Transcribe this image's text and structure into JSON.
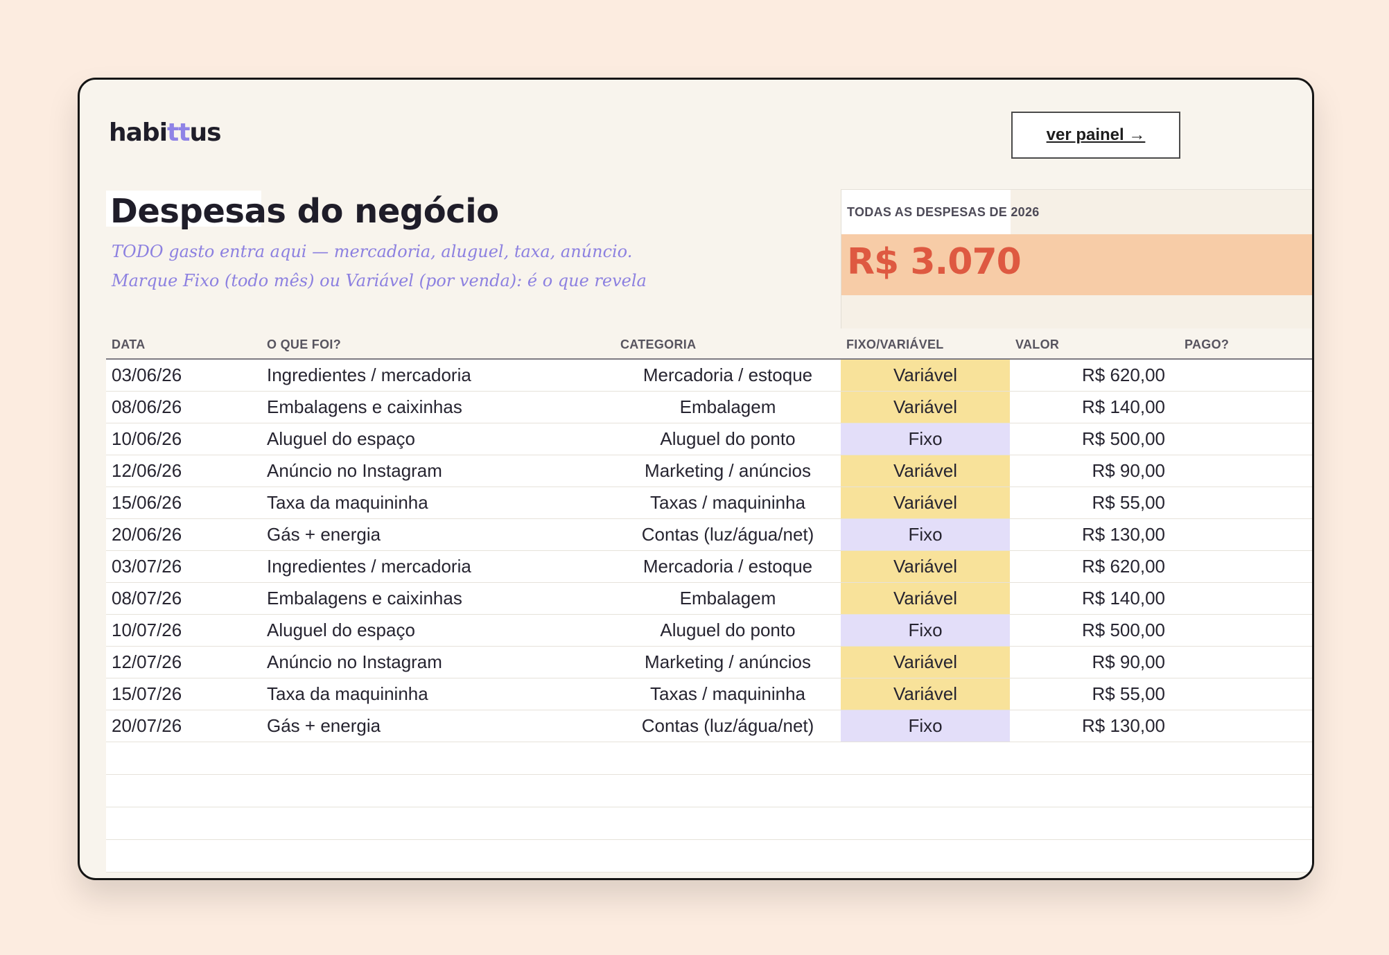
{
  "app": {
    "logo_prefix": "habi",
    "logo_highlight": "tt",
    "logo_suffix": "us"
  },
  "header": {
    "panel_button": "ver painel →"
  },
  "page": {
    "title": "Despesas do negócio",
    "subtitle_line1": "TODO gasto entra aqui — mercadoria, aluguel, taxa, anúncio.",
    "subtitle_line2": "Marque Fixo (todo mês) ou Variável (por venda): é o que revela"
  },
  "summary": {
    "label": "TODAS AS DESPESAS DE 2026",
    "value": "R$ 3.070"
  },
  "table": {
    "columns": [
      "DATA",
      "O QUE FOI?",
      "CATEGORIA",
      "FIXO/VARIÁVEL",
      "VALOR",
      "PAGO?"
    ],
    "rows": [
      {
        "data": "03/06/26",
        "item": "Ingredientes / mercadoria",
        "categoria": "Mercadoria / estoque",
        "tipo": "Variável",
        "valor": "R$ 620,00",
        "pago": ""
      },
      {
        "data": "08/06/26",
        "item": "Embalagens e caixinhas",
        "categoria": "Embalagem",
        "tipo": "Variável",
        "valor": "R$ 140,00",
        "pago": ""
      },
      {
        "data": "10/06/26",
        "item": "Aluguel do espaço",
        "categoria": "Aluguel do ponto",
        "tipo": "Fixo",
        "valor": "R$ 500,00",
        "pago": ""
      },
      {
        "data": "12/06/26",
        "item": "Anúncio no Instagram",
        "categoria": "Marketing / anúncios",
        "tipo": "Variável",
        "valor": "R$ 90,00",
        "pago": ""
      },
      {
        "data": "15/06/26",
        "item": "Taxa da maquininha",
        "categoria": "Taxas / maquininha",
        "tipo": "Variável",
        "valor": "R$ 55,00",
        "pago": ""
      },
      {
        "data": "20/06/26",
        "item": "Gás + energia",
        "categoria": "Contas (luz/água/net)",
        "tipo": "Fixo",
        "valor": "R$ 130,00",
        "pago": ""
      },
      {
        "data": "03/07/26",
        "item": "Ingredientes / mercadoria",
        "categoria": "Mercadoria / estoque",
        "tipo": "Variável",
        "valor": "R$ 620,00",
        "pago": ""
      },
      {
        "data": "08/07/26",
        "item": "Embalagens e caixinhas",
        "categoria": "Embalagem",
        "tipo": "Variável",
        "valor": "R$ 140,00",
        "pago": ""
      },
      {
        "data": "10/07/26",
        "item": "Aluguel do espaço",
        "categoria": "Aluguel do ponto",
        "tipo": "Fixo",
        "valor": "R$ 500,00",
        "pago": ""
      },
      {
        "data": "12/07/26",
        "item": "Anúncio no Instagram",
        "categoria": "Marketing / anúncios",
        "tipo": "Variável",
        "valor": "R$ 90,00",
        "pago": ""
      },
      {
        "data": "15/07/26",
        "item": "Taxa da maquininha",
        "categoria": "Taxas / maquininha",
        "tipo": "Variável",
        "valor": "R$ 55,00",
        "pago": ""
      },
      {
        "data": "20/07/26",
        "item": "Gás + energia",
        "categoria": "Contas (luz/água/net)",
        "tipo": "Fixo",
        "valor": "R$ 130,00",
        "pago": ""
      }
    ]
  },
  "colors": {
    "background": "#fcece0",
    "accent": "#8c80e0",
    "total": "#de5941",
    "total_bg": "#f7cca7",
    "variavel_bg": "#f8e29a",
    "fixo_bg": "#e3def9"
  }
}
